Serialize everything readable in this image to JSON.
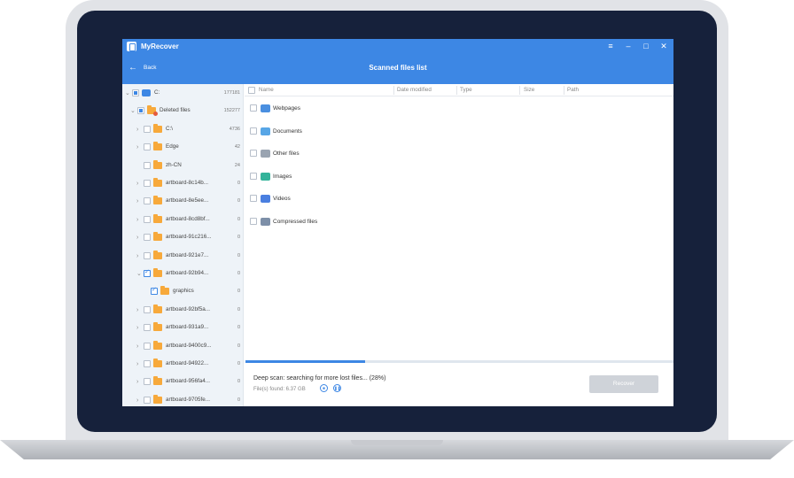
{
  "window": {
    "app_name": "MyRecover",
    "menu_icon": "hamburger-menu-icon",
    "minimize_icon": "minimize-icon",
    "maximize_icon": "maximize-icon",
    "close_icon": "close-icon"
  },
  "nav": {
    "back_label": "Back",
    "page_title": "Scanned files list"
  },
  "tree": [
    {
      "label": "C:",
      "count": "177181",
      "level": 0,
      "expanded": true,
      "check": "partial",
      "icon": "drive-icon"
    },
    {
      "label": "Deleted files",
      "count": "152277",
      "level": 1,
      "expanded": true,
      "check": "partial",
      "icon": "deleted-folder-icon"
    },
    {
      "label": "C:\\",
      "count": "4736",
      "level": 2,
      "expanded": false,
      "check": "none",
      "icon": "folder-icon"
    },
    {
      "label": "Edge",
      "count": "42",
      "level": 2,
      "expanded": false,
      "check": "none",
      "icon": "folder-icon"
    },
    {
      "label": "zh-CN",
      "count": "24",
      "level": 2,
      "expanded": null,
      "check": "none",
      "icon": "folder-icon"
    },
    {
      "label": "artboard-8c14b...",
      "count": "0",
      "level": 2,
      "expanded": false,
      "check": "none",
      "icon": "folder-icon"
    },
    {
      "label": "artboard-8e5ee...",
      "count": "0",
      "level": 2,
      "expanded": false,
      "check": "none",
      "icon": "folder-icon"
    },
    {
      "label": "artboard-8cd8bf...",
      "count": "0",
      "level": 2,
      "expanded": false,
      "check": "none",
      "icon": "folder-icon"
    },
    {
      "label": "artboard-91c216...",
      "count": "0",
      "level": 2,
      "expanded": false,
      "check": "none",
      "icon": "folder-icon"
    },
    {
      "label": "artboard-921e7...",
      "count": "0",
      "level": 2,
      "expanded": false,
      "check": "none",
      "icon": "folder-icon"
    },
    {
      "label": "artboard-92b94...",
      "count": "0",
      "level": 2,
      "expanded": true,
      "check": "checked",
      "icon": "folder-icon"
    },
    {
      "label": "graphics",
      "count": "0",
      "level": 3,
      "expanded": null,
      "check": "checked",
      "icon": "folder-icon"
    },
    {
      "label": "artboard-92bf5a...",
      "count": "0",
      "level": 2,
      "expanded": false,
      "check": "none",
      "icon": "folder-icon"
    },
    {
      "label": "artboard-931a9...",
      "count": "0",
      "level": 2,
      "expanded": false,
      "check": "none",
      "icon": "folder-icon"
    },
    {
      "label": "artboard-9400c9...",
      "count": "0",
      "level": 2,
      "expanded": false,
      "check": "none",
      "icon": "folder-icon"
    },
    {
      "label": "artboard-94922...",
      "count": "0",
      "level": 2,
      "expanded": false,
      "check": "none",
      "icon": "folder-icon"
    },
    {
      "label": "artboard-956fa4...",
      "count": "0",
      "level": 2,
      "expanded": false,
      "check": "none",
      "icon": "folder-icon"
    },
    {
      "label": "artboard-9705fe...",
      "count": "0",
      "level": 2,
      "expanded": false,
      "check": "none",
      "icon": "folder-icon"
    }
  ],
  "list_header": {
    "name": "Name",
    "date_modified": "Date modified",
    "type": "Type",
    "size": "Size",
    "path": "Path"
  },
  "file_types": [
    {
      "label": "Webpages",
      "icon": "webpage-icon",
      "color": "#4a8fe0"
    },
    {
      "label": "Documents",
      "icon": "document-icon",
      "color": "#58a6e6"
    },
    {
      "label": "Other files",
      "icon": "other-files-icon",
      "color": "#9aa4b1"
    },
    {
      "label": "Images",
      "icon": "image-icon",
      "color": "#33b39a"
    },
    {
      "label": "Videos",
      "icon": "video-icon",
      "color": "#4a7fe0"
    },
    {
      "label": "Compressed files",
      "icon": "compressed-file-icon",
      "color": "#7d8fa8"
    }
  ],
  "scan": {
    "status_text": "Deep scan: searching for more lost files... (28%)",
    "progress": 0.28,
    "found_text": "File(s) found: 6.37 GB",
    "stop_icon": "stop-icon",
    "pause_icon": "pause-icon"
  },
  "actions": {
    "recover_label": "Recover"
  },
  "colors": {
    "accent": "#3d87e4",
    "folder": "#f7a93b",
    "disabled_button": "#cfd3d9"
  }
}
